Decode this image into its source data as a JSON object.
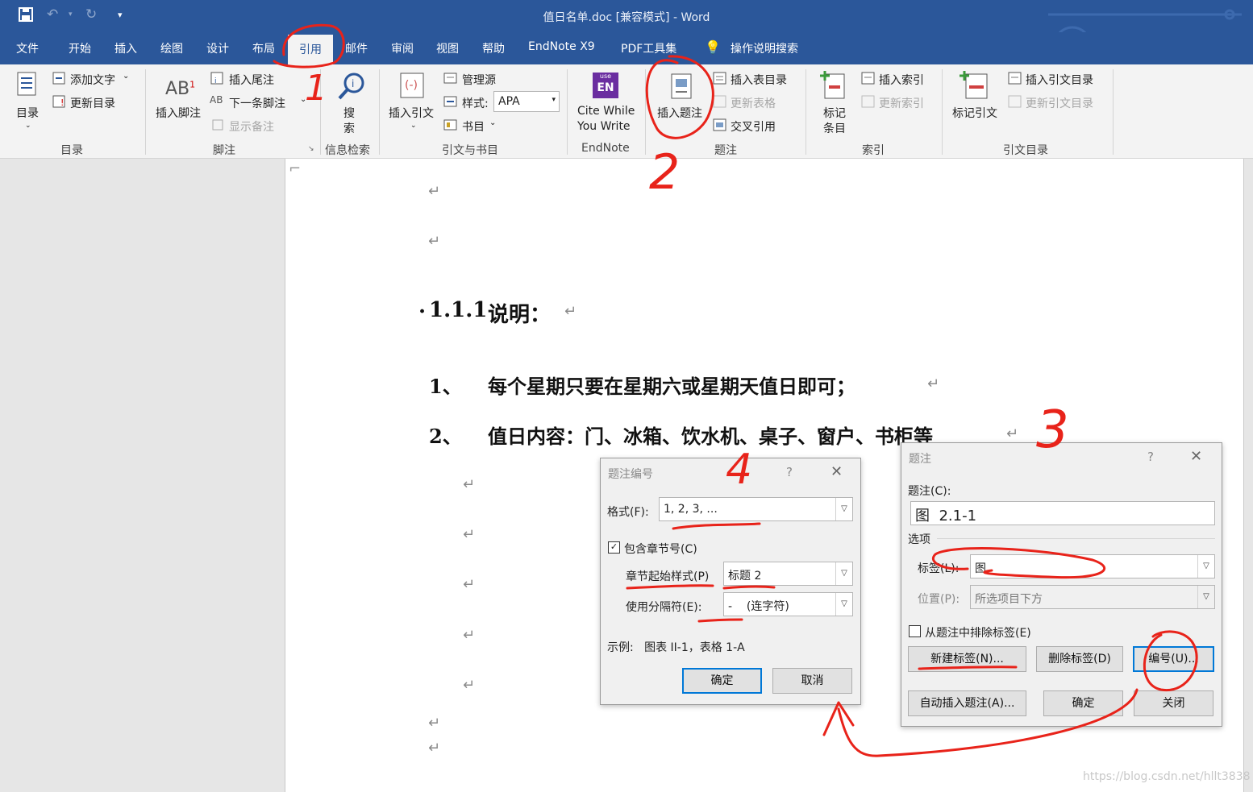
{
  "window": {
    "title": "值日名单.doc [兼容模式] - Word"
  },
  "tabs": [
    "文件",
    "开始",
    "插入",
    "绘图",
    "设计",
    "布局",
    "引用",
    "邮件",
    "审阅",
    "视图",
    "帮助",
    "EndNote X9",
    "PDF工具集",
    "操作说明搜索"
  ],
  "active_tab": "引用",
  "ribbon": {
    "toc": {
      "big": "目录",
      "add_text": "添加文字",
      "update": "更新目录",
      "group": "目录"
    },
    "footnote": {
      "insert": "插入脚注",
      "endnote": "插入尾注",
      "next": "下一条脚注",
      "show": "显示备注",
      "group": "脚注"
    },
    "research": {
      "search1": "搜",
      "search2": "索",
      "group": "信息检索"
    },
    "citation": {
      "insert": "插入引文",
      "manage": "管理源",
      "style_label": "样式:",
      "style_value": "APA",
      "biblio": "书目",
      "group": "引文与书目"
    },
    "endnote": {
      "cwyw1": "Cite While",
      "cwyw2": "You Write",
      "group": "EndNote",
      "logo_top": "use",
      "logo": "EN"
    },
    "captions": {
      "insert": "插入题注",
      "insert_tof": "插入表目录",
      "update_table": "更新表格",
      "cross_ref": "交叉引用",
      "group": "题注"
    },
    "index": {
      "mark1": "标记",
      "mark2": "条目",
      "insert": "插入索引",
      "update": "更新索引",
      "group": "索引"
    },
    "toa": {
      "mark": "标记引文",
      "insert": "插入引文目录",
      "update": "更新引文目录",
      "group": "引文目录"
    }
  },
  "document": {
    "heading_num": "1.1.1",
    "heading_text": "说明：",
    "items": [
      {
        "num": "1、",
        "text": "每个星期只要在星期六或星期天值日即可；"
      },
      {
        "num": "2、",
        "text": "值日内容：门、冰箱、饮水机、桌子、窗户、书柜等"
      }
    ],
    "para_mark": "↵"
  },
  "dialog_numbering": {
    "title": "题注编号",
    "help": "?",
    "close": "✕",
    "format_label": "格式(F):",
    "format_value": "1, 2, 3, ...",
    "include_chapter_label": "包含章节号(C)",
    "include_chapter_checked": "✓",
    "chapter_style_label": "章节起始样式(P)",
    "chapter_style_value": "标题 2",
    "separator_label": "使用分隔符(E):",
    "separator_value": "-    (连字符)",
    "example": "示例:   图表 II-1，表格 1-A",
    "ok": "确定",
    "cancel": "取消"
  },
  "dialog_caption": {
    "title": "题注",
    "help": "?",
    "close": "✕",
    "caption_label": "题注(C):",
    "caption_value": "图  2.1-1",
    "options_label": "选项",
    "label_label": "标签(L):",
    "label_value": "图",
    "position_label": "位置(P):",
    "position_value": "所选项目下方",
    "exclude_label": "从题注中排除标签(E)",
    "new_label": "新建标签(N)...",
    "delete_label": "删除标签(D)",
    "numbering": "编号(U)...",
    "autocaption": "自动插入题注(A)...",
    "ok": "确定",
    "close_btn": "关闭"
  },
  "annotations": [
    "1",
    "2",
    "3",
    "4"
  ],
  "watermark": "https://blog.csdn.net/hllt3838",
  "colors": {
    "word_blue": "#2b579a",
    "annotation_red": "#e8231a",
    "accent": "#0078d7"
  }
}
